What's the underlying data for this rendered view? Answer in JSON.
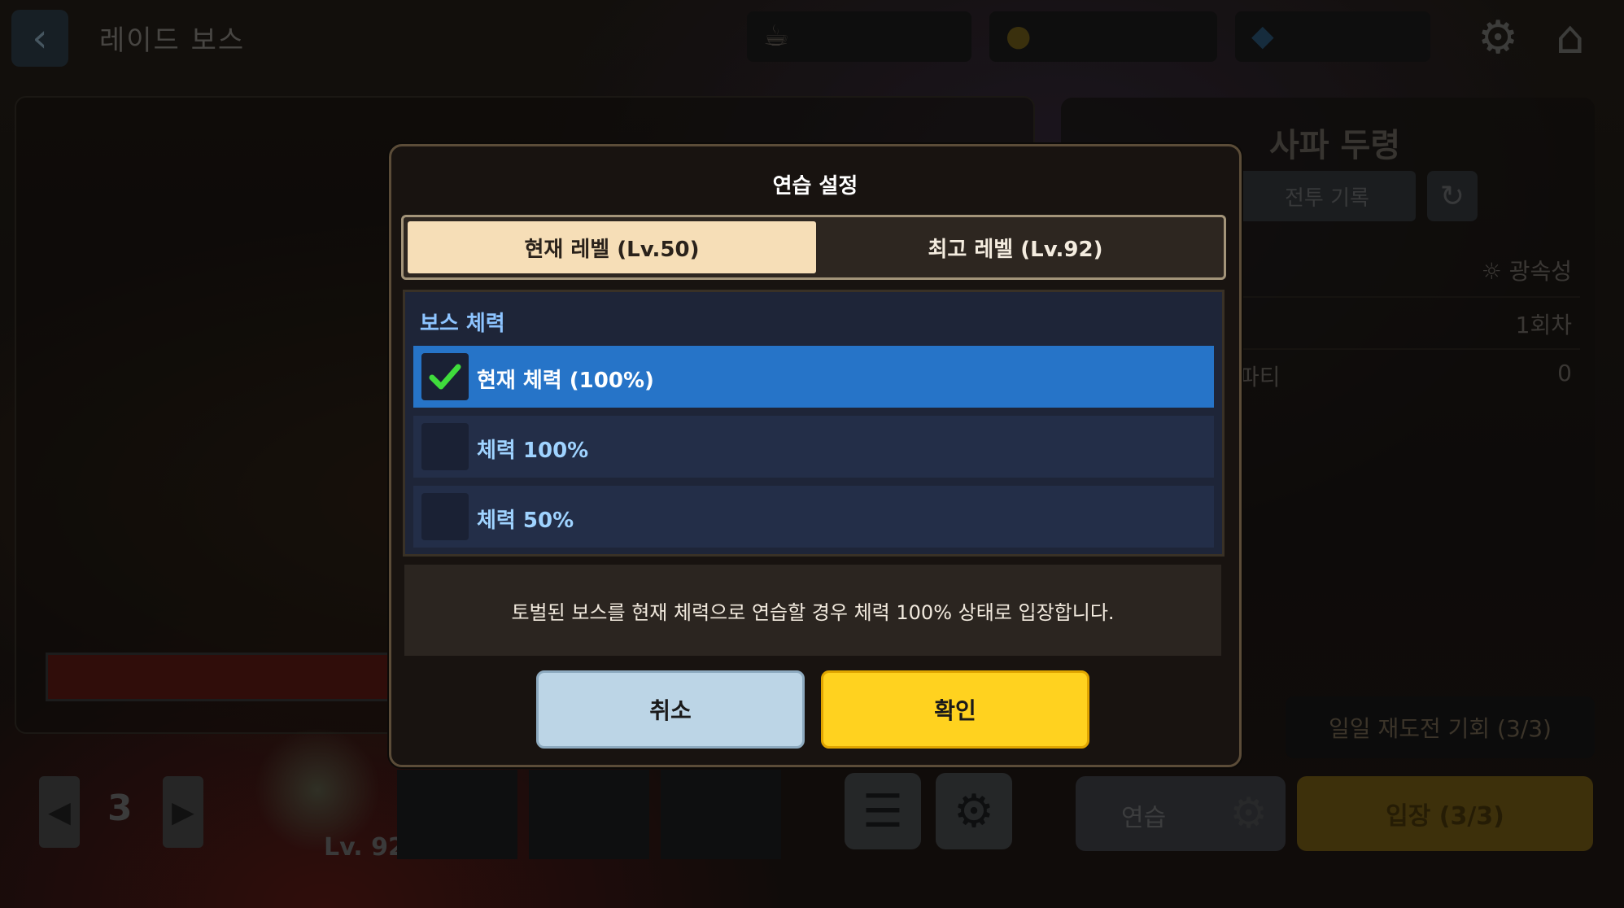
{
  "screen": {
    "title": "레이드 보스"
  },
  "top_bar": {
    "back_icon": "chevron-left-icon",
    "resources": [
      {
        "icon": "coffee-cup-icon",
        "value": ""
      },
      {
        "icon": "coin-icon",
        "value": ""
      },
      {
        "icon": "diamond-icon",
        "value": ""
      }
    ],
    "settings_icon": "gear-icon",
    "home_icon": "home-icon"
  },
  "boss_panel": {
    "name": "사파 두령",
    "battle_log_label": "전투 기록",
    "attribute": "광속성",
    "round": "1회차",
    "party_label": "파티",
    "party_value": "0",
    "daily_retry": "일일 재도전 기회 (3/3)",
    "practice_label": "연습",
    "enter_label": "입장 (3/3)"
  },
  "lower_left": {
    "page_number": "3",
    "hero_level": "Lv. 92"
  },
  "modal": {
    "title": "연습 설정",
    "tabs": [
      {
        "label": "현재 레벨 (Lv.50)",
        "active": true
      },
      {
        "label": "최고 레벨 (Lv.92)",
        "active": false
      }
    ],
    "section_title": "보스 체력",
    "options": [
      {
        "label": "현재 체력 (100%)",
        "selected": true
      },
      {
        "label": "체력 100%",
        "selected": false
      },
      {
        "label": "체력 50%",
        "selected": false
      }
    ],
    "note": "토벌된 보스를 현재 체력으로 연습할 경우 체력 100% 상태로 입장합니다.",
    "cancel_label": "취소",
    "confirm_label": "확인"
  },
  "colors": {
    "selected_option": "#2674c8",
    "confirm_button": "#ffd21f",
    "cancel_button": "#bcd5e6",
    "active_tab": "#f6deb7",
    "check_mark": "#3fdc3c"
  }
}
